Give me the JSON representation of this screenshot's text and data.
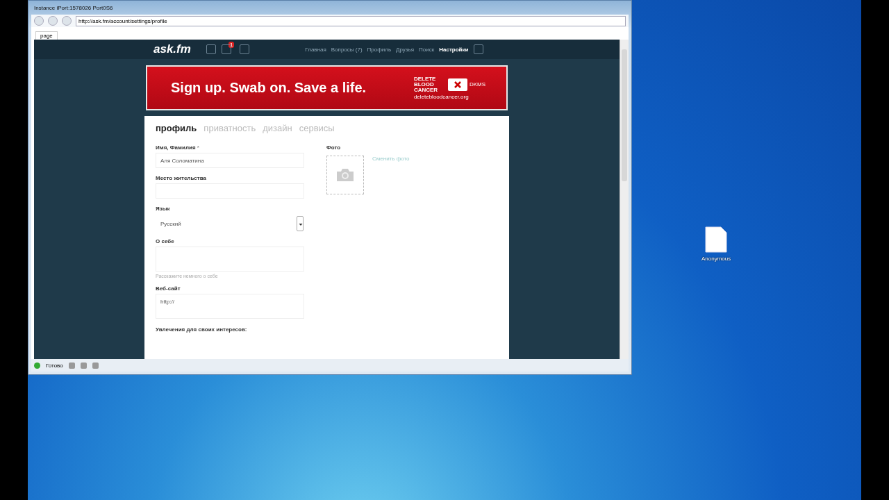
{
  "window": {
    "title": "Instance iPort:1578026 Port0S6"
  },
  "browser": {
    "address": "http://ask.fm/account/settings/profile",
    "tabs": [
      {
        "label": "page",
        "selected": true
      }
    ],
    "status": "Готово"
  },
  "site": {
    "logo": "ask.fm",
    "notification_badge": "1",
    "nav": [
      {
        "label": "Главная",
        "selected": false
      },
      {
        "label": "Вопросы (7)",
        "selected": false
      },
      {
        "label": "Профиль",
        "selected": false
      },
      {
        "label": "Друзья",
        "selected": false
      },
      {
        "label": "Поиск",
        "selected": false
      },
      {
        "label": "Настройки",
        "selected": true
      }
    ]
  },
  "ad": {
    "headline": "Sign up. Swab on. Save a life.",
    "brand": "DELETE BLOOD CANCER",
    "partner": "DKMS",
    "url": "deletebloodcancer.org"
  },
  "settings_tabs": [
    {
      "label": "профиль",
      "selected": true
    },
    {
      "label": "приватность",
      "selected": false
    },
    {
      "label": "дизайн",
      "selected": false
    },
    {
      "label": "сервисы",
      "selected": false
    }
  ],
  "form": {
    "fields": [
      {
        "kind": "text",
        "label": "Имя, Фамилия",
        "required": true,
        "value": "Аля Соломатина"
      },
      {
        "kind": "text",
        "label": "Место жительства",
        "required": false
      },
      {
        "kind": "select",
        "label": "Язык",
        "required": false,
        "value": "Русский"
      },
      {
        "kind": "textarea",
        "label": "О себе",
        "required": false,
        "hint": "Расскажите немного о себе"
      },
      {
        "kind": "textarea",
        "label": "Веб-сайт",
        "required": false,
        "value": "http://"
      },
      {
        "kind": "label",
        "label": "Увлечения для своих интересов:",
        "required": false
      }
    ],
    "required_mark": "*",
    "photo": {
      "label": "Фото",
      "action": "Сменить фото"
    }
  },
  "desktop": {
    "icons": [
      {
        "label": "Anonymous"
      }
    ]
  }
}
